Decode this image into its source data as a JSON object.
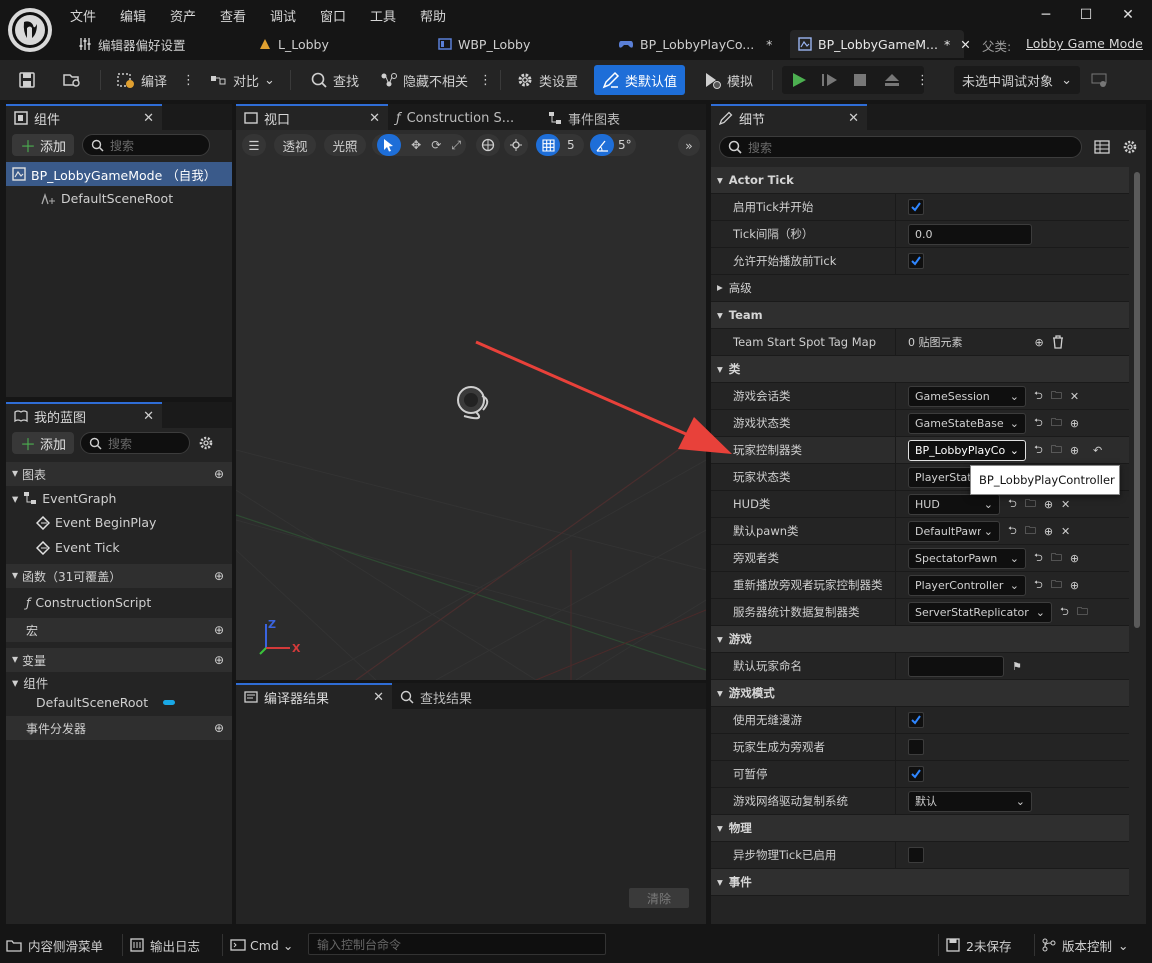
{
  "menus": [
    "文件",
    "编辑",
    "资产",
    "查看",
    "调试",
    "窗口",
    "工具",
    "帮助"
  ],
  "tabs": {
    "editor_prefs": "编辑器偏好设置",
    "l_lobby": "L_Lobby",
    "wbp_lobby": "WBP_Lobby",
    "bp_playcontroller": "BP_LobbyPlayCo...",
    "bp_gamemode": "BP_LobbyGameM...",
    "modified_mark": "*",
    "parent_label": "父类:",
    "parent_value": "Lobby Game Mode"
  },
  "toolbar": {
    "compile": "编译",
    "diff": "对比",
    "find": "查找",
    "hide_unrelated": "隐藏不相关",
    "class_settings": "类设置",
    "class_defaults": "类默认值",
    "simulate": "模拟",
    "debug_target": "未选中调试对象"
  },
  "components": {
    "title": "组件",
    "add": "添加",
    "search_placeholder": "搜索",
    "root_item": "BP_LobbyGameMode （自我）",
    "child_item": "DefaultSceneRoot"
  },
  "myblueprint": {
    "title": "我的蓝图",
    "add": "添加",
    "search_placeholder": "搜索",
    "graphs": "图表",
    "event_graph": "EventGraph",
    "begin_play": "Event BeginPlay",
    "tick": "Event Tick",
    "functions": "函数（31可覆盖）",
    "construction_script": "ConstructionScript",
    "macros": "宏",
    "variables": "变量",
    "components": "组件",
    "default_scene_root": "DefaultSceneRoot",
    "dispatchers": "事件分发器"
  },
  "viewport": {
    "tab": "视口",
    "construction_tab": "Construction S...",
    "event_graph_tab": "事件图表",
    "perspective": "透视",
    "lighting": "光照",
    "grid_size": "5",
    "angle": "5°",
    "axis_z": "Z",
    "axis_x": "X"
  },
  "results": {
    "compiler_tab": "编译器结果",
    "find_tab": "查找结果",
    "clear": "清除"
  },
  "details": {
    "title": "细节",
    "search_placeholder": "搜索",
    "categories": {
      "actor_tick": "Actor Tick",
      "advanced": "高级",
      "team": "Team",
      "classes": "类",
      "game": "游戏",
      "game_mode": "游戏模式",
      "physics": "物理",
      "events": "事件"
    },
    "props": {
      "tick_enabled": "启用Tick并开始",
      "tick_interval": "Tick间隔（秒）",
      "tick_interval_value": "0.0",
      "tick_before_begin": "允许开始播放前Tick",
      "team_spot_map": "Team Start Spot Tag Map",
      "team_spot_value": "0 贴图元素",
      "game_session": "游戏会话类",
      "game_session_value": "GameSession",
      "game_state": "游戏状态类",
      "game_state_value": "GameStateBase",
      "player_controller": "玩家控制器类",
      "player_controller_value": "BP_LobbyPlayCo",
      "player_state": "玩家状态类",
      "player_state_value": "PlayerState",
      "hud": "HUD类",
      "hud_value": "HUD",
      "default_pawn": "默认pawn类",
      "default_pawn_value": "DefaultPawn",
      "spectator": "旁观者类",
      "spectator_value": "SpectatorPawn",
      "replay_spectator": "重新播放旁观者玩家控制器类",
      "replay_spectator_value": "PlayerController",
      "server_stat": "服务器统计数据复制器类",
      "server_stat_value": "ServerStatReplicator",
      "default_player_name": "默认玩家命名",
      "seamless_travel": "使用无缝漫游",
      "start_spectator": "玩家生成为旁观者",
      "pausable": "可暂停",
      "net_driver_repl": "游戏网络驱动复制系统",
      "net_driver_value": "默认",
      "async_physics_tick": "异步物理Tick已启用"
    },
    "tooltip": "BP_LobbyPlayController"
  },
  "statusbar": {
    "content_drawer": "内容侧滑菜单",
    "output_log": "输出日志",
    "cmd": "Cmd",
    "console_placeholder": "输入控制台命令",
    "unsaved": "2未保存",
    "source_control": "版本控制"
  },
  "colors": {
    "accent": "#2f6dd6",
    "play_green": "#4caf50",
    "arrow_red": "#e8413a"
  }
}
